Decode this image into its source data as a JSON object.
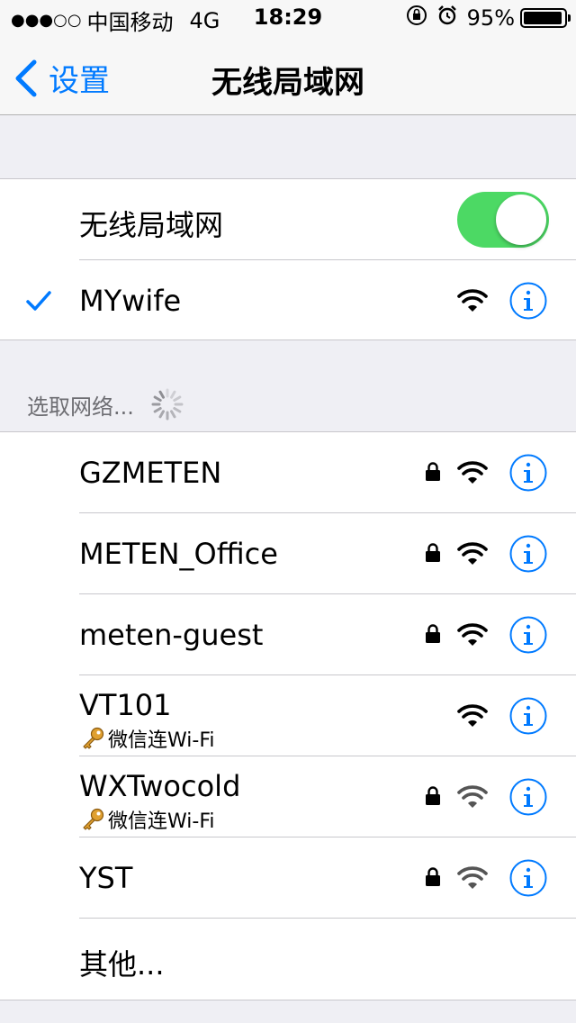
{
  "status_bar": {
    "signal": "●●●○○",
    "carrier": "中国移动",
    "network": "4G",
    "time": "18:29",
    "orientation_lock_icon": "orientation-lock-icon",
    "alarm_icon": "alarm-icon",
    "battery": "95%",
    "battery_level": 0.95
  },
  "nav": {
    "back_label": "设置",
    "title": "无线局域网"
  },
  "wifi_toggle": {
    "label": "无线局域网",
    "on": true,
    "color": "#4cd964"
  },
  "connected": {
    "name": "MYwife",
    "secured": false
  },
  "section": {
    "header": "选取网络..."
  },
  "networks": [
    {
      "name": "GZMETEN",
      "secured": true,
      "subtitle": ""
    },
    {
      "name": "METEN_Office",
      "secured": true,
      "subtitle": ""
    },
    {
      "name": "meten-guest",
      "secured": true,
      "subtitle": ""
    },
    {
      "name": "VT101",
      "secured": false,
      "subtitle": "微信连Wi-Fi"
    },
    {
      "name": "WXTwocold",
      "secured": true,
      "subtitle": "微信连Wi-Fi"
    },
    {
      "name": "YST",
      "secured": true,
      "subtitle": ""
    }
  ],
  "other": {
    "label": "其他..."
  },
  "colors": {
    "accent": "#007aff",
    "background": "#efeff4"
  }
}
